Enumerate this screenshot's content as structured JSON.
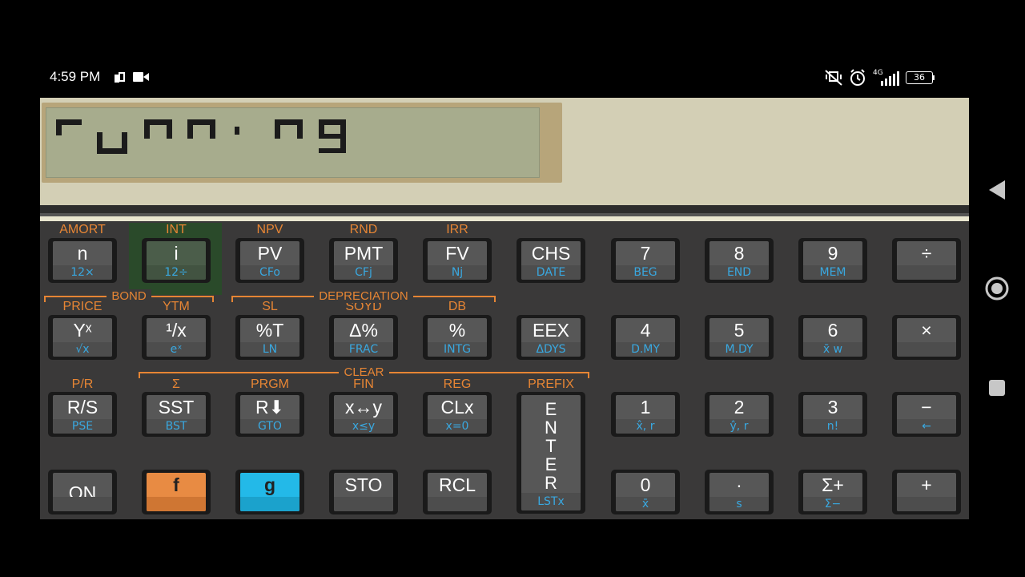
{
  "status_bar": {
    "time": "4:59 PM",
    "network": "4G",
    "battery": "36",
    "icons": [
      "sim-icon",
      "video-icon",
      "mute-vibrate-icon",
      "alarm-icon",
      "signal-icon",
      "battery-icon"
    ]
  },
  "display": {
    "text": "running"
  },
  "row1": {
    "gold": [
      "AMORT",
      "INT",
      "NPV",
      "RND",
      "IRR",
      "",
      "",
      "",
      "",
      ""
    ],
    "keys": [
      {
        "main": "n",
        "low": "12×"
      },
      {
        "main": "i",
        "low": "12÷"
      },
      {
        "main": "PV",
        "low": "CFo"
      },
      {
        "main": "PMT",
        "low": "CFj"
      },
      {
        "main": "FV",
        "low": "Nj"
      },
      {
        "main": "CHS",
        "low": "DATE"
      },
      {
        "main": "7",
        "low": "BEG"
      },
      {
        "main": "8",
        "low": "END"
      },
      {
        "main": "9",
        "low": "MEM"
      },
      {
        "main": "÷",
        "low": ""
      }
    ]
  },
  "groups": {
    "bond": "BOND",
    "depreciation": "DEPRECIATION",
    "clear": "CLEAR"
  },
  "row2": {
    "gold": [
      "PRICE",
      "YTM",
      "SL",
      "SOYD",
      "DB",
      "",
      "",
      "",
      "",
      ""
    ],
    "keys": [
      {
        "main": "Yˣ",
        "low": "√x"
      },
      {
        "main": "¹/x",
        "low": "eˣ"
      },
      {
        "main": "%T",
        "low": "LN"
      },
      {
        "main": "Δ%",
        "low": "FRAC"
      },
      {
        "main": "%",
        "low": "INTG"
      },
      {
        "main": "EEX",
        "low": "ΔDYS"
      },
      {
        "main": "4",
        "low": "D.MY"
      },
      {
        "main": "5",
        "low": "M.DY"
      },
      {
        "main": "6",
        "low": "x̄ w"
      },
      {
        "main": "×",
        "low": ""
      }
    ]
  },
  "row3": {
    "gold": [
      "P/R",
      "Σ",
      "PRGM",
      "FIN",
      "REG",
      "PREFIX",
      "",
      "",
      "",
      ""
    ],
    "keys": [
      {
        "main": "R/S",
        "low": "PSE"
      },
      {
        "main": "SST",
        "low": "BST"
      },
      {
        "main": "R⬇",
        "low": "GTO"
      },
      {
        "main": "x↔y",
        "low": "x≤y"
      },
      {
        "main": "CLx",
        "low": "x=0"
      },
      {
        "main": "E\nN\nT\nE\nR",
        "low": "LSTx"
      },
      {
        "main": "1",
        "low": "x̂, r"
      },
      {
        "main": "2",
        "low": "ŷ, r"
      },
      {
        "main": "3",
        "low": "n!"
      },
      {
        "main": "−",
        "low": "←"
      }
    ]
  },
  "row4": {
    "keys": [
      {
        "main": "ON",
        "low": ""
      },
      {
        "main": "f",
        "low": ""
      },
      {
        "main": "g",
        "low": ""
      },
      {
        "main": "STO",
        "low": ""
      },
      {
        "main": "RCL",
        "low": ""
      },
      {
        "main": "0",
        "low": "x̄"
      },
      {
        "main": "·",
        "low": "s"
      },
      {
        "main": "Σ+",
        "low": "Σ−"
      },
      {
        "main": "+",
        "low": ""
      }
    ]
  },
  "colors": {
    "gold": "#e68534",
    "blue": "#39a8e0",
    "f_key": "#e88b43",
    "g_key": "#23b9e8"
  }
}
